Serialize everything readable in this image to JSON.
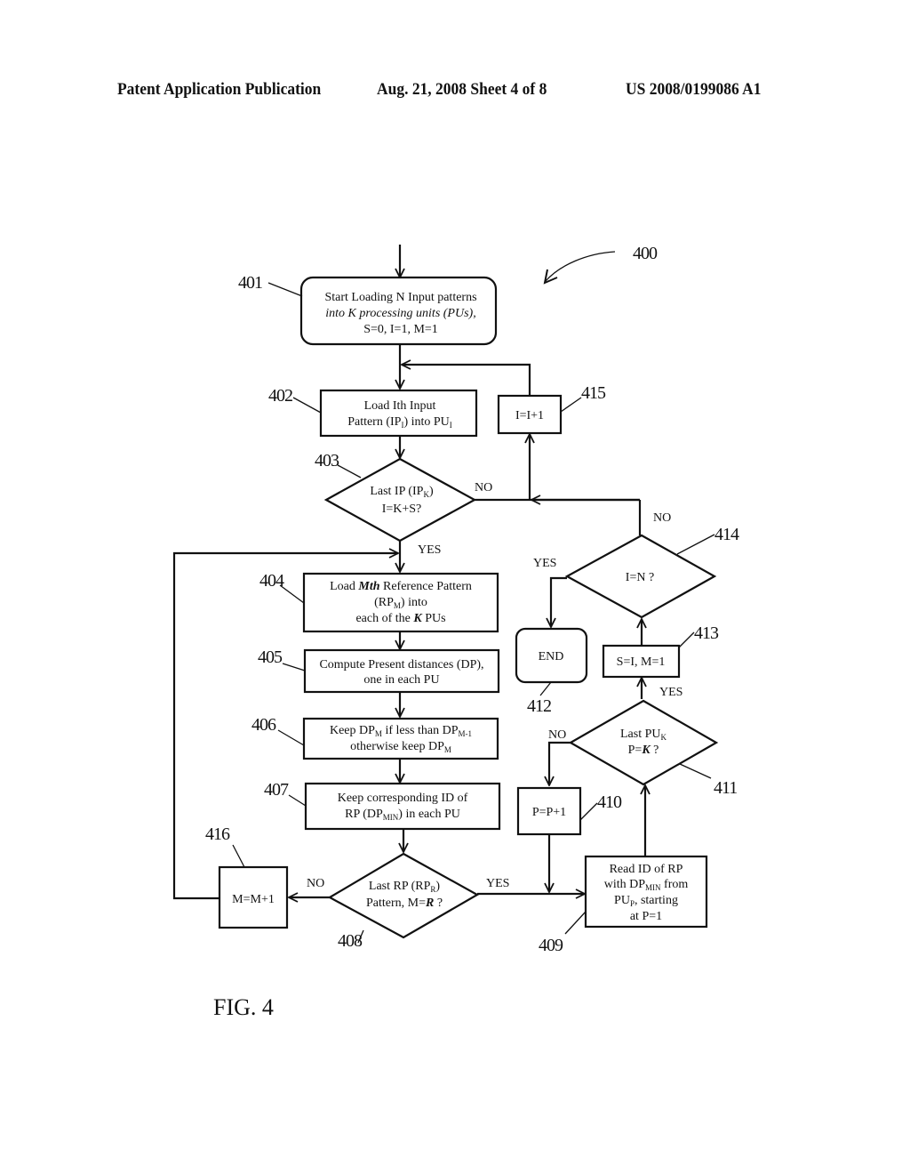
{
  "header": {
    "publication": "Patent Application Publication",
    "date_sheet": "Aug. 21, 2008  Sheet 4 of 8",
    "number": "US 2008/0199086 A1"
  },
  "figure": {
    "label": "FIG. 4",
    "ref": "400"
  },
  "nodes": {
    "n401": {
      "ref": "401",
      "lines": [
        "Start Loading N Input patterns",
        "into K processing units (PUs),",
        "S=0, I=1, M=1"
      ]
    },
    "n402": {
      "ref": "402",
      "lines": [
        "Load Ith Input",
        "Pattern (IP",
        "I",
        ") into  PU",
        "I"
      ]
    },
    "n403": {
      "ref": "403",
      "lines": [
        "Last IP (IP",
        "K",
        ")",
        "I=K+S?"
      ]
    },
    "n404": {
      "ref": "404",
      "lines": [
        "Load Mth Reference Pattern",
        "(RP",
        "M",
        ") into",
        "each of the K  PUs"
      ]
    },
    "n405": {
      "ref": "405",
      "lines": [
        "Compute  Present distances (DP),",
        "one  in each PU"
      ]
    },
    "n406": {
      "ref": "406",
      "lines": [
        "Keep DP",
        "M",
        "  if less than DP",
        "M-1",
        "otherwise keep DP",
        "M"
      ]
    },
    "n407": {
      "ref": "407",
      "lines": [
        "Keep corresponding  ID of",
        "RP (DP",
        "MIN",
        ") in each PU"
      ]
    },
    "n408": {
      "ref": "408",
      "lines": [
        "Last RP (RP",
        "R",
        ")",
        "Pattern, M=R ?"
      ]
    },
    "n409": {
      "ref": "409",
      "lines": [
        "Read ID of RP",
        "with DP",
        "MIN",
        " from",
        "PU",
        "P",
        ", starting",
        "at P=1"
      ]
    },
    "n410": {
      "ref": "410",
      "lines": [
        "P=P+1"
      ]
    },
    "n411": {
      "ref": "411",
      "lines": [
        "Last PU",
        "K",
        "P=K ?"
      ]
    },
    "n412": {
      "ref": "412",
      "lines": [
        "END"
      ]
    },
    "n413": {
      "ref": "413",
      "lines": [
        "S=I, M=1"
      ]
    },
    "n414": {
      "ref": "414",
      "lines": [
        "I=N ?"
      ]
    },
    "n415": {
      "ref": "415",
      "lines": [
        "I=I+1"
      ]
    },
    "n416": {
      "ref": "416",
      "lines": [
        "M=M+1"
      ]
    }
  },
  "edge_labels": {
    "yes": "YES",
    "no": "NO"
  }
}
